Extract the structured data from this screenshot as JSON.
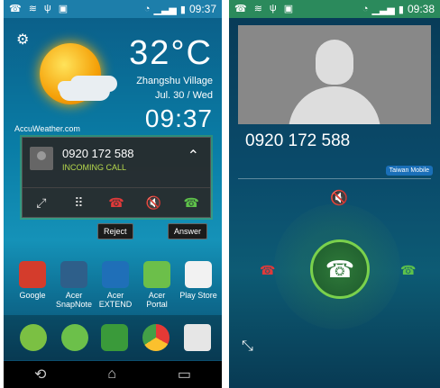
{
  "left": {
    "status": {
      "time": "09:37"
    },
    "weather": {
      "temp": "32°C",
      "city": "Zhangshu Village",
      "date": "Jul. 30 / Wed",
      "clock": "09:37",
      "provider": "AccuWeather.com"
    },
    "incoming": {
      "number": "0920 172 588",
      "label": "INCOMING CALL",
      "reject_tip": "Reject",
      "answer_tip": "Answer"
    },
    "apps": [
      {
        "label": "Google",
        "color": "#ffffff"
      },
      {
        "label": "Acer SnapNote",
        "color": "#2e5f8a"
      },
      {
        "label": "Acer EXTEND",
        "color": "#1f6fb8"
      },
      {
        "label": "Acer Portal",
        "color": "#6cbf4a"
      },
      {
        "label": "Play Store",
        "color": "#ffffff"
      }
    ]
  },
  "right": {
    "status": {
      "time": "09:38"
    },
    "caller_number": "0920 172 588",
    "carrier": "Taiwan Mobile"
  }
}
